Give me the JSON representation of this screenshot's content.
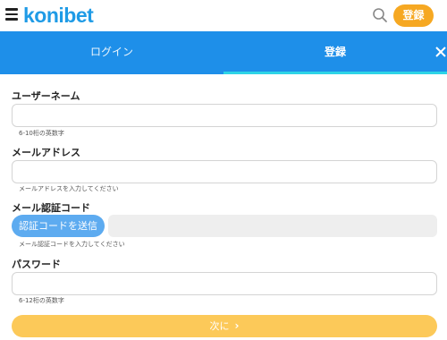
{
  "header": {
    "logo_text": "konibet",
    "register_label": "登録",
    "icons": [
      "menu-icon",
      "search-icon"
    ]
  },
  "tabs": {
    "login_label": "ログイン",
    "register_label": "登録",
    "active": "register",
    "close_icon": "close-icon"
  },
  "form": {
    "username": {
      "label": "ユーザーネーム",
      "value": "",
      "hint": "6-10桁の英数字"
    },
    "email": {
      "label": "メールアドレス",
      "value": "",
      "hint": "メールアドレスを入力してください"
    },
    "verification": {
      "label": "メール認証コード",
      "button_label": "認証コードを送信",
      "value": "",
      "hint": "メール認証コードを入力してください"
    },
    "password": {
      "label": "パスワード",
      "value": "",
      "hint": "6-12桁の英数字"
    },
    "next_label": "次に",
    "next_icon": "chevron-right-icon"
  },
  "colors": {
    "brand_blue": "#1e8fe9",
    "tab_underline": "#2ed4e6",
    "register_orange": "#f6a822",
    "next_button": "#fcc959",
    "send_code_button": "#5dabf0"
  }
}
